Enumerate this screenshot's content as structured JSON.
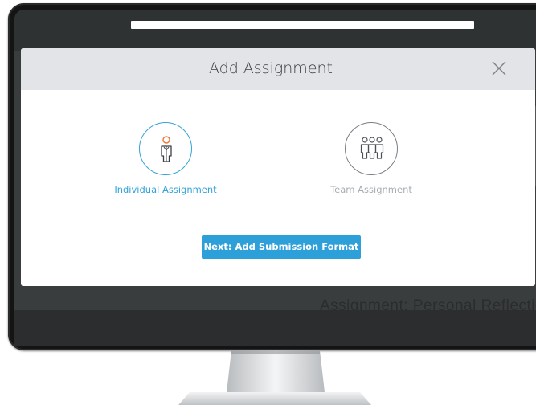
{
  "background_app": {
    "peek_text": "Assignment: Personal Reflectio"
  },
  "modal": {
    "title": "Add Assignment",
    "close_icon": "close-icon",
    "options": [
      {
        "label": "Individual Assignment",
        "icon": "person-icon",
        "selected": true
      },
      {
        "label": "Team Assignment",
        "icon": "team-icon",
        "selected": false
      }
    ],
    "next_button_label": "Next: Add Submission Format"
  },
  "colors": {
    "accent": "#2d9fd9",
    "selected_label": "#35a3d8",
    "person_head": "#f07c3a",
    "muted_label": "#a8adb3",
    "header_bg": "#e2e4e7"
  }
}
